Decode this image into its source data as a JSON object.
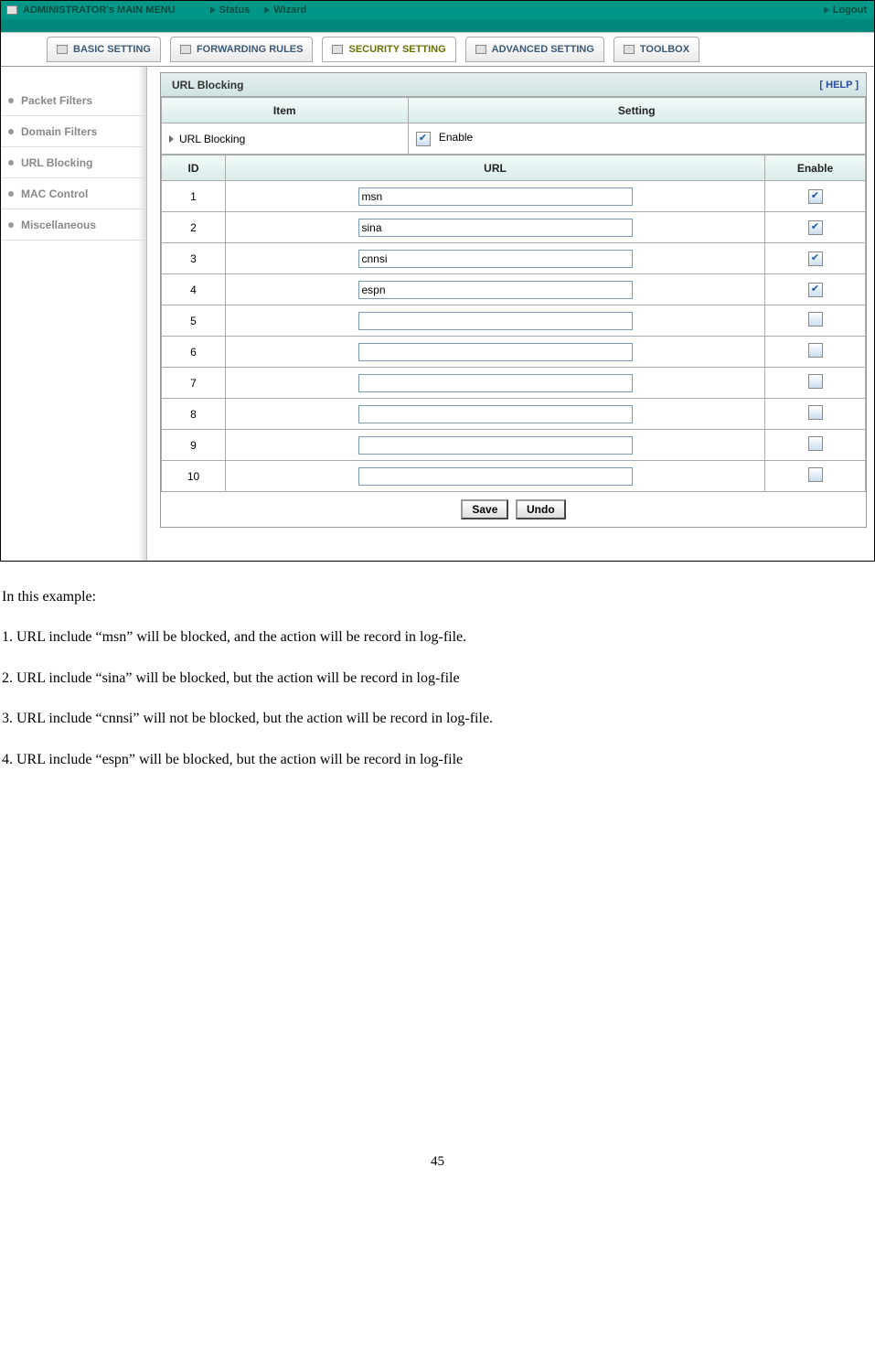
{
  "topbar": {
    "admin_label": "ADMINISTRATOR's MAIN MENU",
    "status": "Status",
    "wizard": "Wizard",
    "logout": "Logout"
  },
  "tabs": {
    "basic": "BASIC SETTING",
    "forward": "FORWARDING RULES",
    "security": "SECURITY SETTING",
    "advanced": "ADVANCED SETTING",
    "toolbox": "TOOLBOX"
  },
  "sidebar": {
    "packet": "Packet Filters",
    "domain": "Domain Filters",
    "url": "URL Blocking",
    "mac": "MAC Control",
    "misc": "Miscellaneous"
  },
  "panel": {
    "title": "URL Blocking",
    "help": "[ HELP ]",
    "item_header": "Item",
    "setting_header": "Setting",
    "urlblocking_label": "URL Blocking",
    "enable_label": "Enable",
    "id_header": "ID",
    "url_header": "URL",
    "enable_header": "Enable",
    "rows": [
      {
        "id": "1",
        "url": "msn",
        "enabled": true
      },
      {
        "id": "2",
        "url": "sina",
        "enabled": true
      },
      {
        "id": "3",
        "url": "cnnsi",
        "enabled": true
      },
      {
        "id": "4",
        "url": "espn",
        "enabled": true
      },
      {
        "id": "5",
        "url": "",
        "enabled": false
      },
      {
        "id": "6",
        "url": "",
        "enabled": false
      },
      {
        "id": "7",
        "url": "",
        "enabled": false
      },
      {
        "id": "8",
        "url": "",
        "enabled": false
      },
      {
        "id": "9",
        "url": "",
        "enabled": false
      },
      {
        "id": "10",
        "url": "",
        "enabled": false
      }
    ],
    "save": "Save",
    "undo": "Undo"
  },
  "doc": {
    "intro": "In this example:",
    "l1": "1. URL include “msn” will be blocked, and the action will be record in log-file.",
    "l2": "2. URL include “sina” will be blocked, but the action will be record in log-file",
    "l3": "3. URL include “cnnsi” will not be blocked, but the action will be record in log-file.",
    "l4": "4. URL include “espn” will be blocked, but the action will be record in log-file",
    "pagenum": "45"
  }
}
